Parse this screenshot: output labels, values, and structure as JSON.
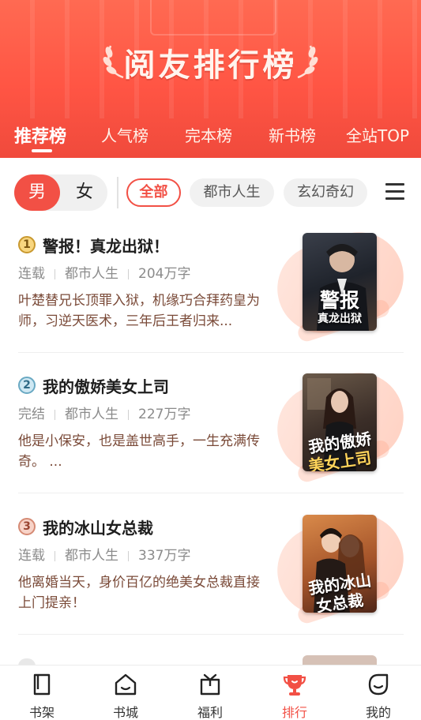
{
  "banner": {
    "title": "阅友排行榜"
  },
  "tabs": [
    {
      "label": "推荐榜",
      "active": true
    },
    {
      "label": "人气榜",
      "active": false
    },
    {
      "label": "完本榜",
      "active": false
    },
    {
      "label": "新书榜",
      "active": false
    },
    {
      "label": "全站TOP",
      "active": false
    }
  ],
  "gender": {
    "male": "男",
    "female": "女",
    "selected": "男"
  },
  "categories": [
    {
      "label": "全部",
      "active": true
    },
    {
      "label": "都市人生",
      "active": false
    },
    {
      "label": "玄幻奇幻",
      "active": false
    }
  ],
  "books": [
    {
      "rank": "1",
      "title": "警报！真龙出狱！",
      "status": "连载",
      "genre": "都市人生",
      "words": "204万字",
      "description": "叶楚替兄长顶罪入狱，机缘巧合拜药皇为师，习逆天医术，三年后王者归来...",
      "cover_text_1": "警报",
      "cover_text_2": "真龙出狱"
    },
    {
      "rank": "2",
      "title": "我的傲娇美女上司",
      "status": "完结",
      "genre": "都市人生",
      "words": "227万字",
      "description": "他是小保安，也是盖世高手，一生充满传奇。 ...",
      "cover_text_1": "我的傲娇",
      "cover_text_2": "美女上司"
    },
    {
      "rank": "3",
      "title": "我的冰山女总裁",
      "status": "连载",
      "genre": "都市人生",
      "words": "337万字",
      "description": "他离婚当天，身价百亿的绝美女总裁直接上门提亲！",
      "cover_text_1": "我的冰山",
      "cover_text_2": "女总裁"
    }
  ],
  "nav": [
    {
      "label": "书架",
      "icon": "bookshelf-icon",
      "active": false
    },
    {
      "label": "书城",
      "icon": "store-icon",
      "active": false
    },
    {
      "label": "福利",
      "icon": "gift-icon",
      "active": false
    },
    {
      "label": "排行",
      "icon": "trophy-icon",
      "active": true
    },
    {
      "label": "我的",
      "icon": "profile-icon",
      "active": false
    }
  ],
  "colors": {
    "accent": "#f25045",
    "banner": "#ff5a48"
  }
}
